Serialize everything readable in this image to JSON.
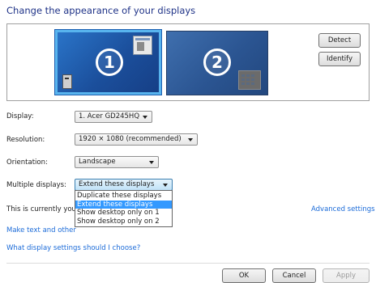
{
  "page": {
    "title": "Change the appearance of your displays"
  },
  "preview": {
    "monitor_1_number": "1",
    "monitor_2_number": "2",
    "detect_label": "Detect",
    "identify_label": "Identify"
  },
  "settings": {
    "display_label": "Display:",
    "display_value": "1. Acer GD245HQ",
    "resolution_label": "Resolution:",
    "resolution_value": "1920 × 1080 (recommended)",
    "orientation_label": "Orientation:",
    "orientation_value": "Landscape",
    "multiple_label": "Multiple displays:",
    "multiple_value": "Extend these displays",
    "multiple_options": [
      "Duplicate these displays",
      "Extend these displays",
      "Show desktop only on 1",
      "Show desktop only on 2"
    ]
  },
  "info": {
    "currently_text": "This is currently you",
    "advanced_link": "Advanced settings",
    "make_text_link": "Make text and other",
    "which_settings_link": "What display settings should I choose?"
  },
  "footer": {
    "ok_label": "OK",
    "cancel_label": "Cancel",
    "apply_label": "Apply"
  },
  "colors": {
    "title": "#1e3287",
    "link": "#1a6ad8",
    "selected": "#3399ff"
  }
}
